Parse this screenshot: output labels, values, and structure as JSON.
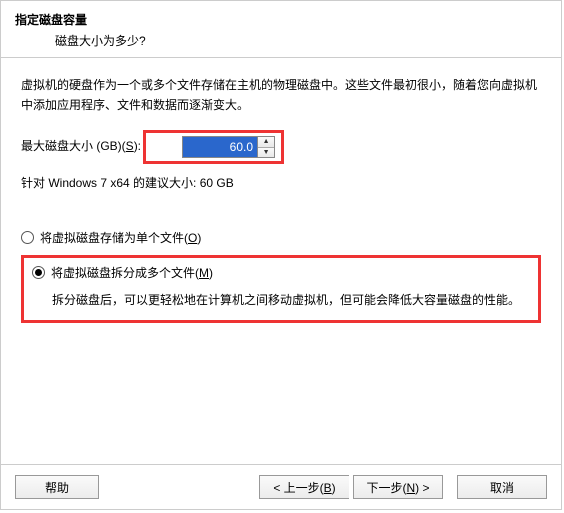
{
  "header": {
    "title": "指定磁盘容量",
    "subtitle": "磁盘大小为多少?"
  },
  "body": {
    "description": "虚拟机的硬盘作为一个或多个文件存储在主机的物理磁盘中。这些文件最初很小，随着您向虚拟机中添加应用程序、文件和数据而逐渐变大。",
    "size_label_pre": "最大磁盘大小 (GB)(",
    "size_hotkey": "S",
    "size_label_post": "):",
    "size_value": "60.0",
    "recommend": "针对 Windows 7 x64 的建议大小: 60 GB",
    "option_single_pre": "将虚拟磁盘存储为单个文件(",
    "option_single_hot": "O",
    "option_single_post": ")",
    "option_split_pre": "将虚拟磁盘拆分成多个文件(",
    "option_split_hot": "M",
    "option_split_post": ")",
    "option_split_desc": "拆分磁盘后，可以更轻松地在计算机之间移动虚拟机，但可能会降低大容量磁盘的性能。"
  },
  "footer": {
    "help": "帮助",
    "back_pre": "< 上一步(",
    "back_hot": "B",
    "back_post": ")",
    "next_pre": "下一步(",
    "next_hot": "N",
    "next_post": ") >",
    "cancel": "取消"
  }
}
